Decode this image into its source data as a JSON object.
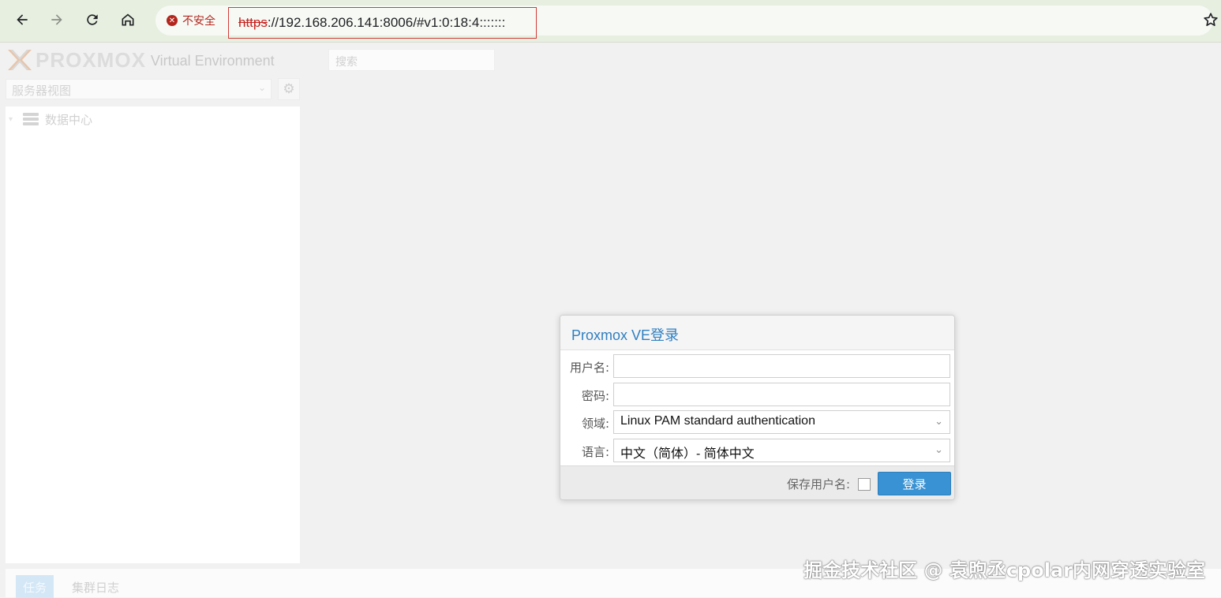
{
  "browser": {
    "security_label": "不安全",
    "url_protocol": "https",
    "url_rest": "://192.168.206.141:8006/#v1:0:18:4:::::::",
    "icons": [
      "back-icon",
      "forward-icon",
      "reload-icon",
      "home-icon",
      "star-icon"
    ]
  },
  "header": {
    "logo_text": "PROXMOX",
    "product": "Virtual Environment",
    "search_placeholder": "搜索"
  },
  "sidebar": {
    "view_select": "服务器视图",
    "tree": [
      {
        "label": "数据中心"
      }
    ]
  },
  "login": {
    "title": "Proxmox VE登录",
    "fields": [
      {
        "label": "用户名:",
        "value": ""
      },
      {
        "label": "密码:",
        "value": ""
      },
      {
        "label": "领域:",
        "value": "Linux PAM standard authentication"
      },
      {
        "label": "语言:",
        "value": "中文（简体）- 简体中文"
      }
    ],
    "remember_label": "保存用户名:",
    "remember_checked": false,
    "submit_label": "登录",
    "accent": "#3892d3",
    "title_color": "#2f7fc1"
  },
  "bottom": {
    "tabs": [
      {
        "label": "任务",
        "active": true
      },
      {
        "label": "集群日志",
        "active": false
      }
    ]
  },
  "watermark": "掘金技术社区 @ 袁煦丞cpolar内网穿透实验室"
}
